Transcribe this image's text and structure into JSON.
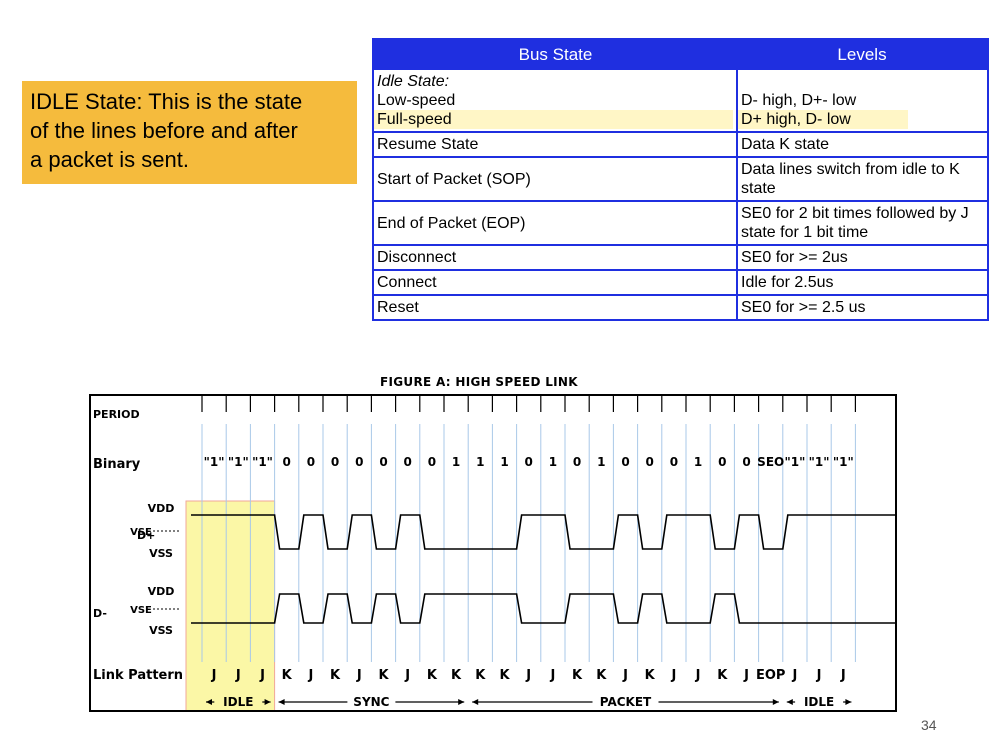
{
  "callout": {
    "lines": [
      "IDLE State: This is the state",
      "of the lines before and after",
      "a packet is sent."
    ]
  },
  "table": {
    "headers": [
      "Bus State",
      "Levels"
    ],
    "idle": {
      "title": "Idle State:",
      "low_speed": "Low-speed",
      "low_speed_level": "D- high, D+- low",
      "full_speed": "Full-speed",
      "full_speed_level": "D+ high, D- low"
    },
    "rows": [
      [
        "Resume State",
        "Data K state"
      ],
      [
        "Start of Packet (SOP)",
        "Data lines switch from idle to K state"
      ],
      [
        "End of Packet (EOP)",
        "SE0 for 2 bit times followed by J state for 1 bit time"
      ],
      [
        "Disconnect",
        "SE0 for >= 2us"
      ],
      [
        "Connect",
        "Idle for 2.5us"
      ],
      [
        "Reset",
        "SE0 for >= 2.5 us"
      ]
    ]
  },
  "figure": {
    "title": "FIGURE A: HIGH SPEED LINK",
    "labels": {
      "period": "PERIOD",
      "binary": "Binary",
      "dplus": "D+",
      "dminus": "D-",
      "vdd": "VDD",
      "vse": "VSE",
      "vss": "VSS",
      "link_pattern": "Link Pattern"
    },
    "binary_values": [
      "\"1\"",
      "\"1\"",
      "\"1\"",
      "0",
      "0",
      "0",
      "0",
      "0",
      "0",
      "0",
      "1",
      "1",
      "1",
      "0",
      "1",
      "0",
      "1",
      "0",
      "0",
      "0",
      "1",
      "0",
      "0",
      "SEO",
      "\"1\"",
      "\"1\"",
      "\"1\""
    ],
    "link_pattern": [
      "J",
      "J",
      "J",
      "K",
      "J",
      "K",
      "J",
      "K",
      "J",
      "K",
      "K",
      "K",
      "K",
      "J",
      "J",
      "K",
      "K",
      "J",
      "K",
      "J",
      "J",
      "K",
      "J",
      "EOP",
      "J",
      "J",
      "J"
    ],
    "segments": [
      {
        "label": "IDLE",
        "from": 0,
        "to": 3
      },
      {
        "label": "SYNC",
        "from": 3,
        "to": 11
      },
      {
        "label": "PACKET",
        "from": 11,
        "to": 24
      },
      {
        "label": "IDLE",
        "from": 24,
        "to": 27
      }
    ],
    "highlight": {
      "from": 0,
      "to": 3,
      "color": "#fbf7a6"
    }
  },
  "colors": {
    "table_border": "#1f2fe0",
    "table_header_bg": "#1f2fe0",
    "callout_bg": "#f5bb3d",
    "grid_line": "#a9c8e8"
  },
  "slide_number": "34"
}
